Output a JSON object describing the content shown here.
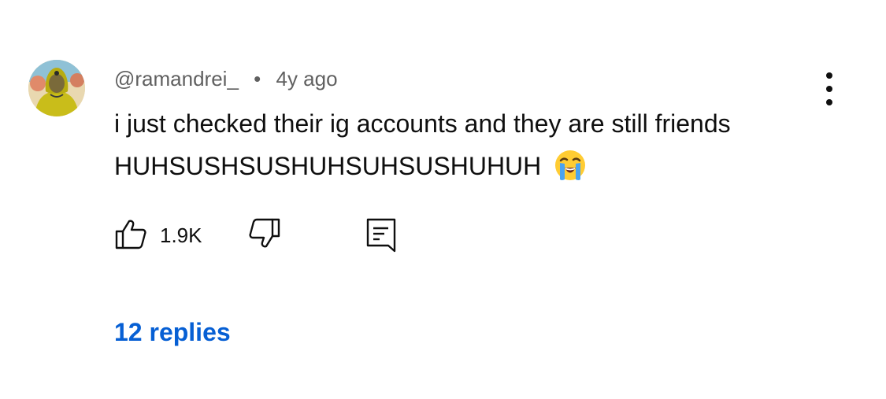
{
  "comment": {
    "author": "@ramandrei_",
    "separator": "•",
    "timestamp": "4y ago",
    "text": "i just checked their ig accounts and they are still friends HUHSUSHSUSHUHSUHSUSHUHUH",
    "emoji": "loudly-crying-face",
    "like_count": "1.9K",
    "replies_label": "12 replies"
  },
  "icons": {
    "like": "thumbs-up-icon",
    "dislike": "thumbs-down-icon",
    "reply": "comment-icon",
    "more": "more-vertical-icon"
  },
  "colors": {
    "text": "#0f0f0f",
    "meta": "#606060",
    "link": "#065fd4"
  }
}
